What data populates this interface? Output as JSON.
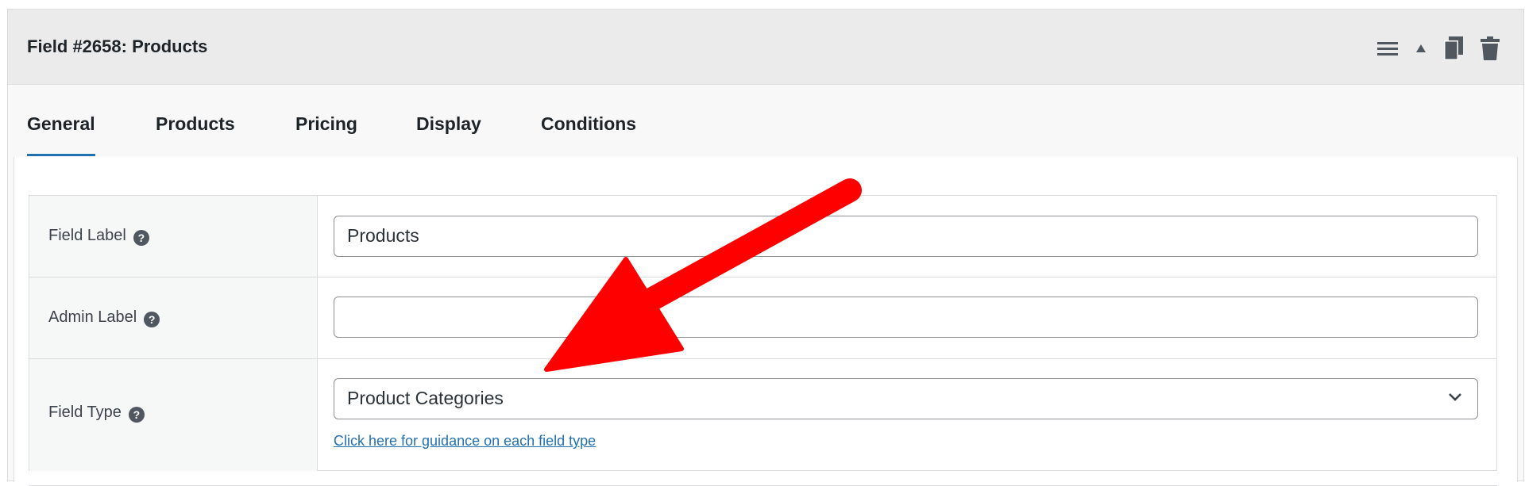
{
  "header": {
    "title": "Field #2658: Products",
    "actions": [
      "menu-icon",
      "collapse-icon",
      "duplicate-icon",
      "trash-icon"
    ]
  },
  "tabs": [
    {
      "label": "General",
      "active": true
    },
    {
      "label": "Products",
      "active": false
    },
    {
      "label": "Pricing",
      "active": false
    },
    {
      "label": "Display",
      "active": false
    },
    {
      "label": "Conditions",
      "active": false
    }
  ],
  "rows": {
    "field_label": {
      "label": "Field Label",
      "help": "?",
      "value": "Products"
    },
    "admin_label": {
      "label": "Admin Label",
      "help": "?",
      "value": ""
    },
    "field_type": {
      "label": "Field Type",
      "help": "?",
      "selected": "Product Categories",
      "guide_link": "Click here for guidance on each field type"
    }
  },
  "colors": {
    "accent": "#2271b1",
    "annotation_arrow": "#ff0000"
  }
}
